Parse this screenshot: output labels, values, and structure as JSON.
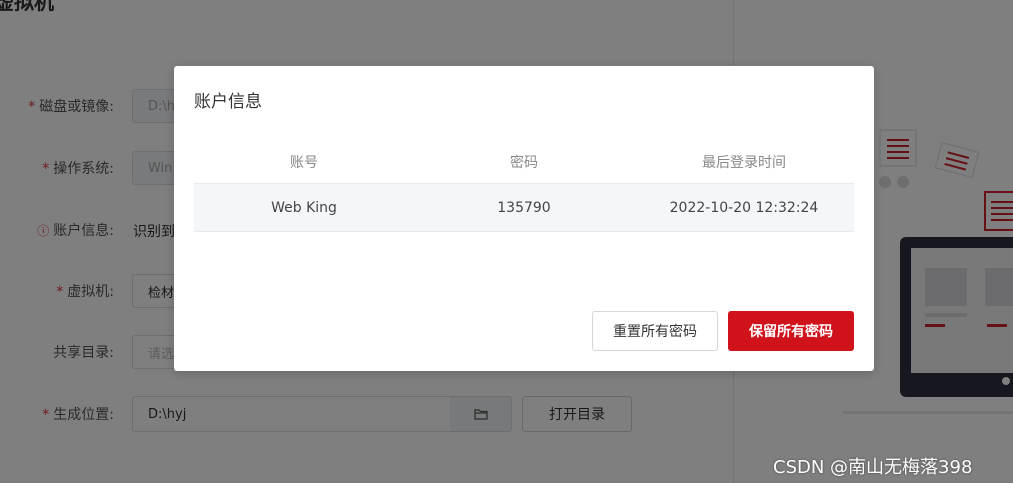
{
  "page": {
    "title": "虚拟机",
    "form": {
      "disk": {
        "label": "磁盘或镜像:",
        "value": "D:\\hy"
      },
      "os": {
        "label": "操作系统:",
        "value": "Win"
      },
      "account": {
        "label": "账户信息:",
        "value": "识别到"
      },
      "vm": {
        "label": "虚拟机:",
        "value": "检材"
      },
      "share": {
        "label": "共享目录:",
        "placeholder": "请选"
      },
      "output": {
        "label": "生成位置:",
        "value": "D:\\hyj",
        "open_label": "打开目录"
      }
    }
  },
  "dialog": {
    "title": "账户信息",
    "columns": [
      "账号",
      "密码",
      "最后登录时间"
    ],
    "rows": [
      [
        "Web King",
        "135790",
        "2022-10-20 12:32:24"
      ]
    ],
    "reset_label": "重置所有密码",
    "keep_label": "保留所有密码"
  },
  "watermark": "CSDN @南山无梅落398",
  "colors": {
    "primary": "#d0121b",
    "overlay": "rgba(0,0,0,0.5)"
  }
}
